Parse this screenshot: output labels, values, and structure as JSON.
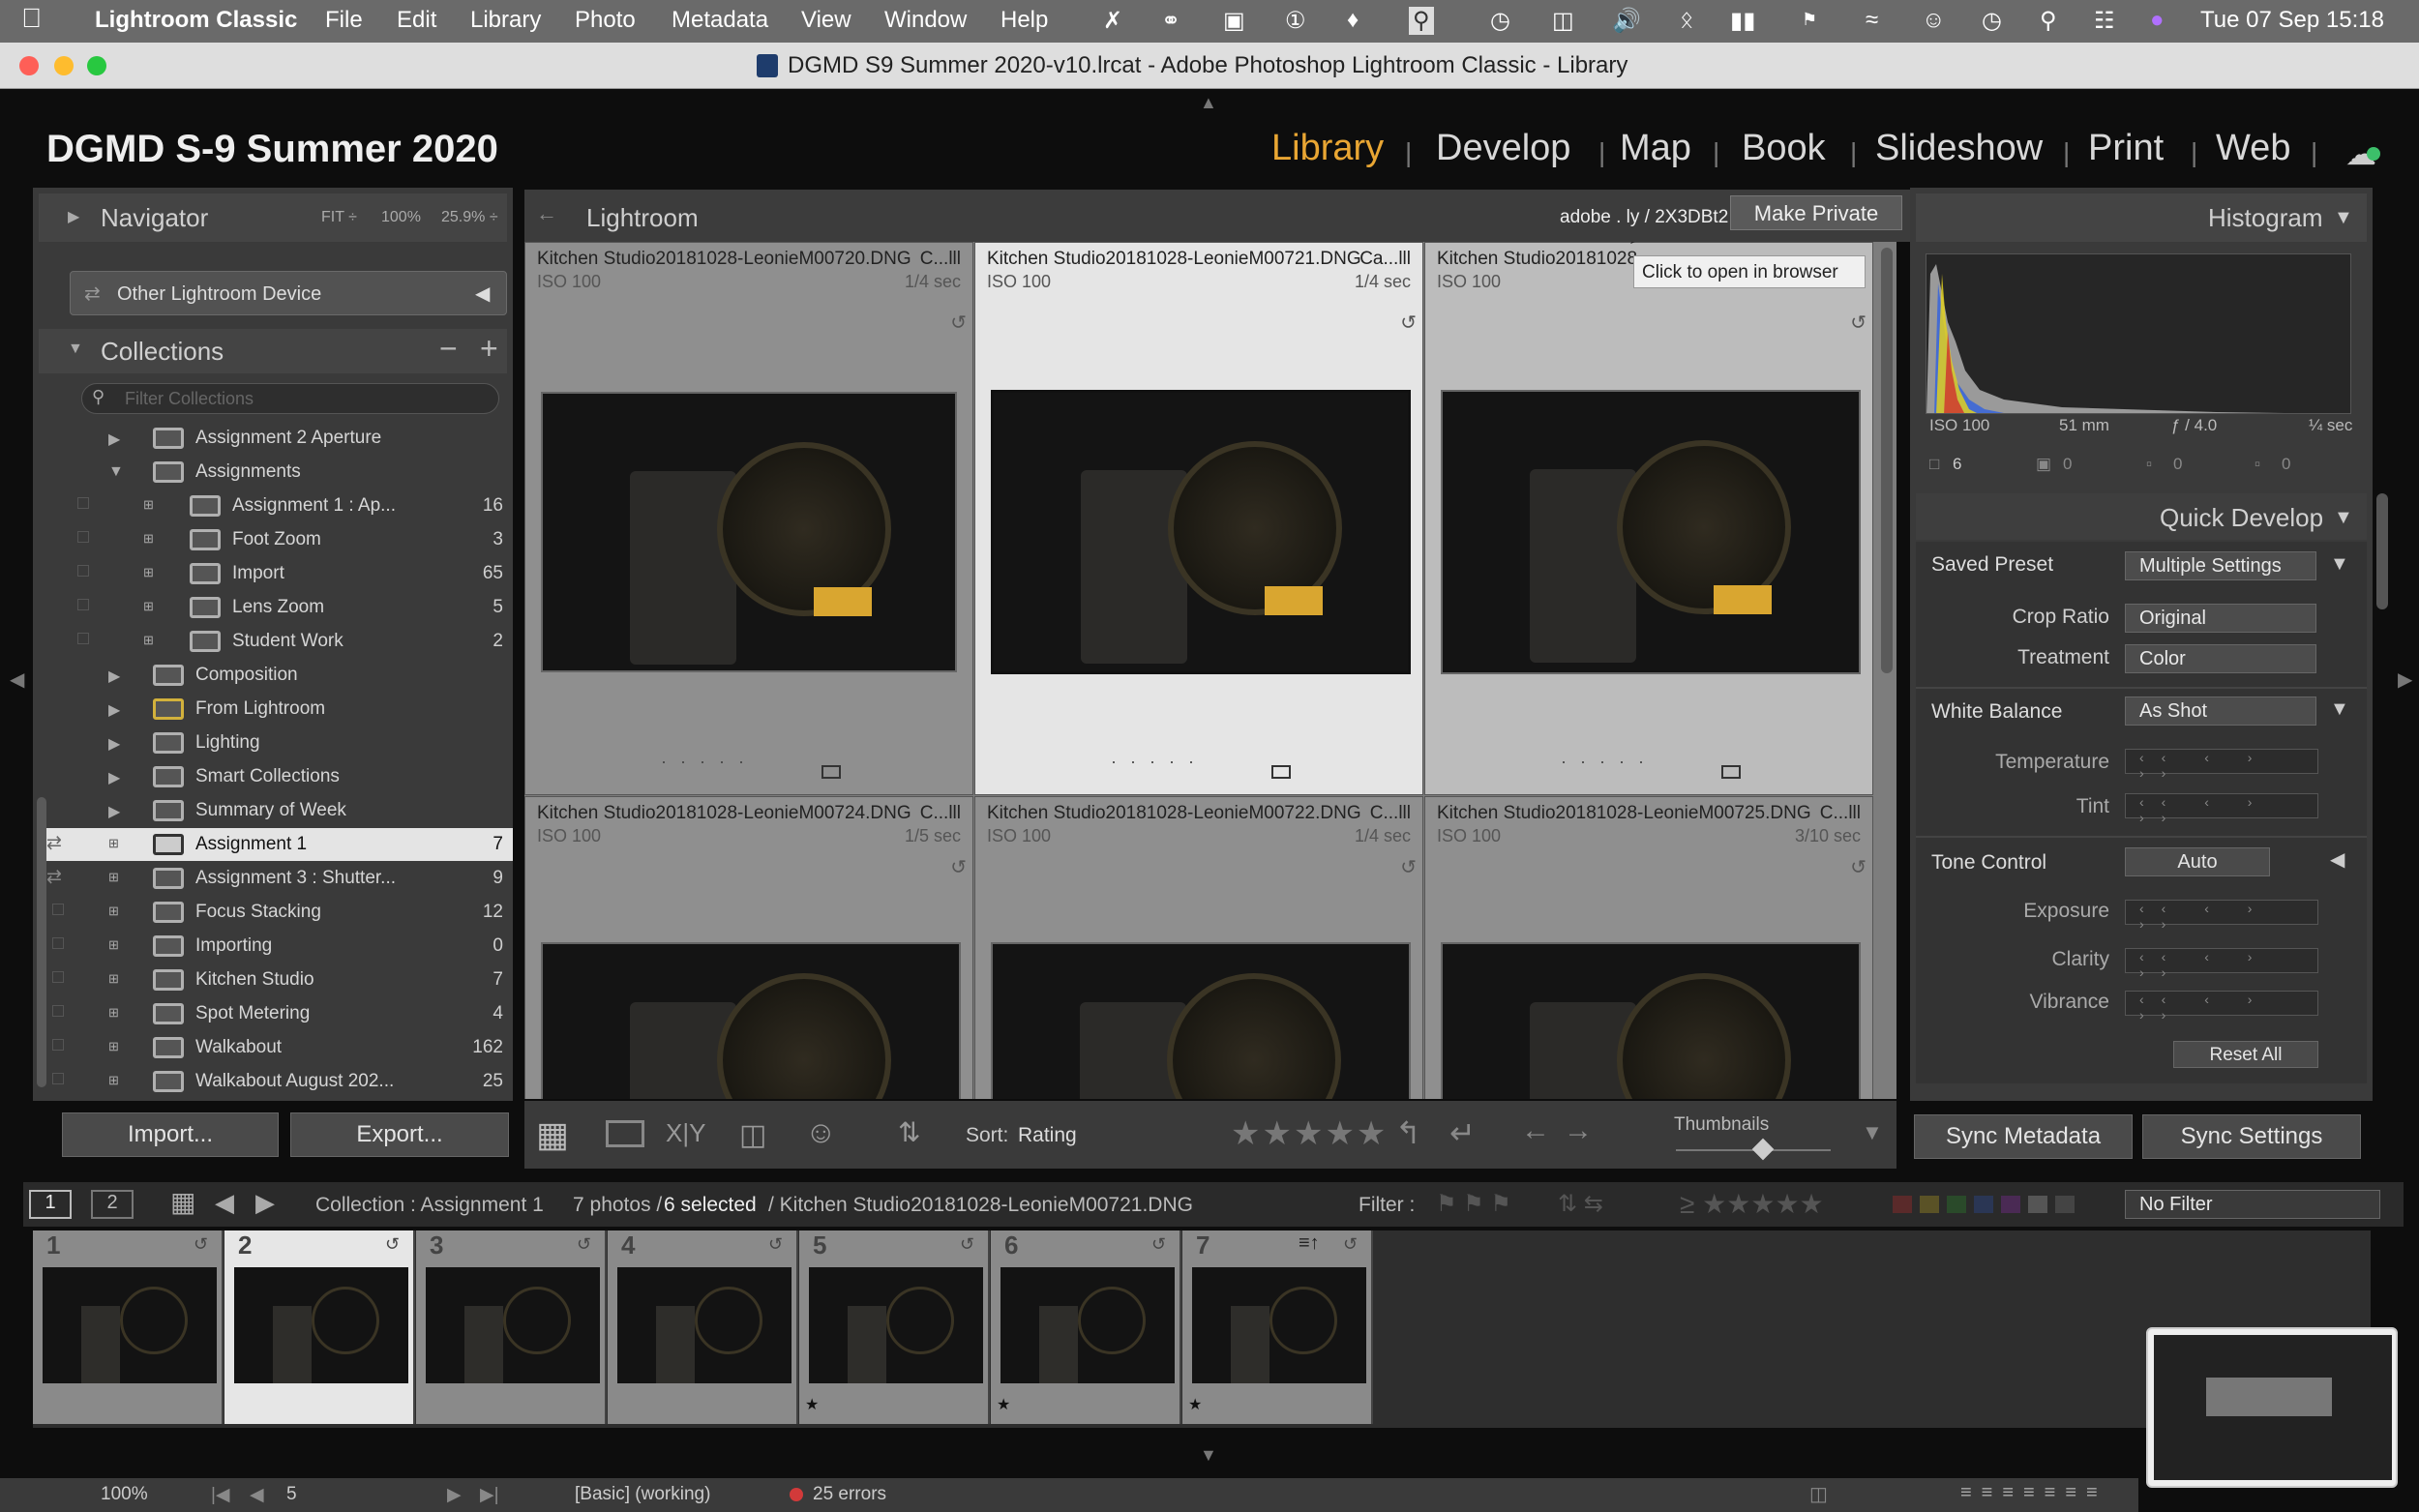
{
  "menubar": {
    "app": "Lightroom Classic",
    "items": [
      "File",
      "Edit",
      "Library",
      "Photo",
      "Metadata",
      "View",
      "Window",
      "Help"
    ],
    "clock": "Tue 07 Sep  15:18"
  },
  "window": {
    "title": "DGMD S9 Summer 2020-v10.lrcat - Adobe Photoshop Lightroom Classic - Library"
  },
  "identity": "DGMD S-9 Summer 2020",
  "modules": [
    "Library",
    "Develop",
    "Map",
    "Book",
    "Slideshow",
    "Print",
    "Web"
  ],
  "active_module": "Library",
  "navigator": {
    "title": "Navigator",
    "zoom": [
      "FIT ÷",
      "100%",
      "25.9% ÷"
    ]
  },
  "publish": {
    "device": "Other Lightroom Device"
  },
  "collections": {
    "title": "Collections",
    "filter_placeholder": "Filter Collections",
    "items": [
      {
        "name": "Assignment 2 Aperture",
        "count": ""
      },
      {
        "name": "Assignments",
        "count": ""
      },
      {
        "name": "Assignment 1 : Ap...",
        "count": "16"
      },
      {
        "name": "Foot Zoom",
        "count": "3"
      },
      {
        "name": "Import",
        "count": "65"
      },
      {
        "name": "Lens Zoom",
        "count": "5"
      },
      {
        "name": "Student Work",
        "count": "2"
      },
      {
        "name": "Composition",
        "count": ""
      },
      {
        "name": "From Lightroom",
        "count": ""
      },
      {
        "name": "Lighting",
        "count": ""
      },
      {
        "name": "Smart Collections",
        "count": ""
      },
      {
        "name": "Summary of Week",
        "count": ""
      },
      {
        "name": "Assignment 1",
        "count": "7"
      },
      {
        "name": "Assignment 3 : Shutter...",
        "count": "9"
      },
      {
        "name": "Focus Stacking",
        "count": "12"
      },
      {
        "name": "Importing",
        "count": "0"
      },
      {
        "name": "Kitchen Studio",
        "count": "7"
      },
      {
        "name": "Spot Metering",
        "count": "4"
      },
      {
        "name": "Walkabout",
        "count": "162"
      },
      {
        "name": "Walkabout August 202...",
        "count": "25"
      }
    ]
  },
  "left_buttons": {
    "import": "Import...",
    "export": "Export..."
  },
  "grid": {
    "header": "Lightroom",
    "link": "adobe . ly / 2X3DBt2",
    "make_private": "Make Private",
    "tooltip": "Click to open in browser",
    "cells": [
      {
        "file": "Kitchen Studio20181028-LeonieM00720.DNG",
        "cam": "C...lll",
        "iso": "ISO 100",
        "speed": "1/4 sec"
      },
      {
        "file": "Kitchen Studio20181028-LeonieM00721.DNG",
        "cam": "Ca...lll",
        "iso": "ISO 100",
        "speed": "1/4 sec"
      },
      {
        "file": "Kitchen Studio20181028-",
        "cam": "",
        "iso": "ISO 100",
        "speed": "1/4 sec"
      },
      {
        "file": "Kitchen Studio20181028-LeonieM00724.DNG",
        "cam": "C...lll",
        "iso": "ISO 100",
        "speed": "1/5 sec"
      },
      {
        "file": "Kitchen Studio20181028-LeonieM00722.DNG",
        "cam": "C...lll",
        "iso": "ISO 100",
        "speed": "1/4 sec"
      },
      {
        "file": "Kitchen Studio20181028-LeonieM00725.DNG",
        "cam": "C...lll",
        "iso": "ISO 100",
        "speed": "3/10 sec"
      }
    ]
  },
  "toolbar": {
    "sort_label": "Sort:",
    "sort_value": "Rating",
    "thumbnails": "Thumbnails"
  },
  "histogram": {
    "title": "Histogram",
    "iso": "ISO 100",
    "focal": "51 mm",
    "aperture": "ƒ / 4.0",
    "shutter": "¼ sec",
    "counts": [
      "6",
      "0",
      "0",
      "0"
    ]
  },
  "quick_develop": {
    "title": "Quick Develop",
    "saved_preset_label": "Saved Preset",
    "saved_preset": "Multiple Settings",
    "crop_label": "Crop Ratio",
    "crop": "Original",
    "treatment_label": "Treatment",
    "treatment": "Color",
    "wb_label": "White Balance",
    "wb": "As Shot",
    "temperature": "Temperature",
    "tint": "Tint",
    "tone_label": "Tone Control",
    "auto": "Auto",
    "exposure": "Exposure",
    "clarity": "Clarity",
    "vibrance": "Vibrance",
    "reset": "Reset All",
    "slot_glyphs": "‹‹ ‹ › ››"
  },
  "right_buttons": {
    "sync_metadata": "Sync Metadata",
    "sync_settings": "Sync Settings"
  },
  "filmstrip_bar": {
    "page1": "1",
    "page2": "2",
    "source": "Collection : Assignment 1",
    "count": "7 photos /",
    "selected": "6 selected",
    "file": "/ Kitchen Studio20181028-LeonieM00721.DNG",
    "filter_label": "Filter :",
    "no_filter": "No Filter"
  },
  "filmstrip": [
    "1",
    "2",
    "3",
    "4",
    "5",
    "6",
    "7"
  ],
  "statusbar": {
    "zoom": "100%",
    "page": "5",
    "mode": "[Basic] (working)",
    "errors": "25 errors"
  }
}
